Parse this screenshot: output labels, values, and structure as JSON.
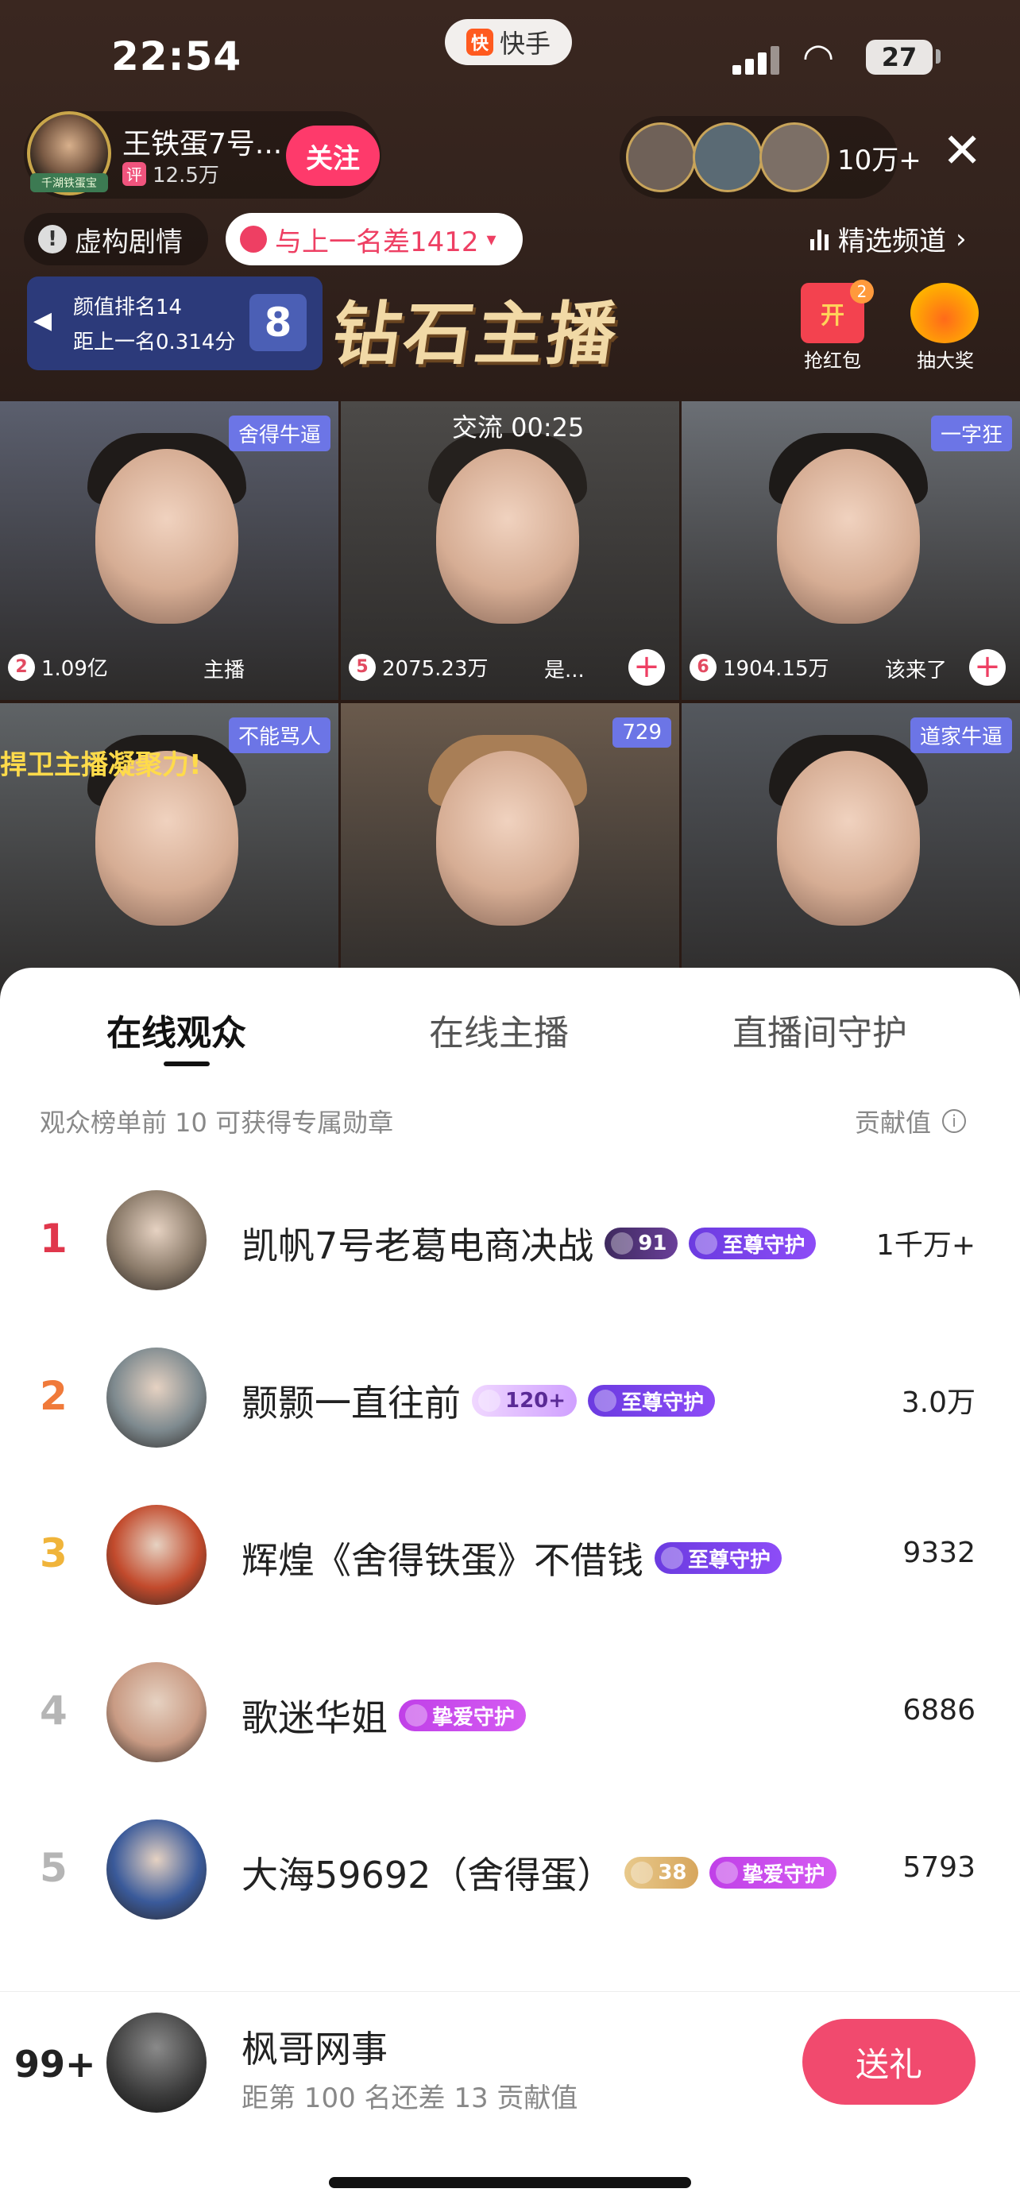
{
  "status_bar": {
    "time": "22:54",
    "app_name": "快手",
    "app_logo_glyph": "快",
    "battery": "27"
  },
  "host": {
    "name": "王铁蛋7号...",
    "badge_text": "千湖铁蛋宝",
    "comment_icon_text": "评",
    "followers": "12.5万",
    "follow_label": "关注"
  },
  "viewers": {
    "count": "10万+"
  },
  "top_pills": {
    "fictional_label": "虚构剧情",
    "gap_label": "与上一名差1412",
    "channel_label": "精选频道"
  },
  "rank_card": {
    "line1": "颜值排名14",
    "line2": "距上一名0.314分"
  },
  "banner_title": "钻石主播",
  "activities": {
    "red_packet": {
      "glyph": "开",
      "count": "2",
      "label": "抢红包"
    },
    "lottery": {
      "label": "抽大奖"
    }
  },
  "grid": {
    "tiles": [
      {
        "tag": "舍得牛逼",
        "rank": "2",
        "count": "1.09亿",
        "note": "主播",
        "bg": "#5b5f6e",
        "hair": "#1f1b19",
        "has_plus": false
      },
      {
        "tag": "",
        "top_text": "交流 00:25",
        "rank": "5",
        "count": "2075.23万",
        "note": "是...",
        "bg": "#4c4a48",
        "hair": "#25211e",
        "has_plus": true
      },
      {
        "tag": "一字狂",
        "rank": "6",
        "count": "1904.15万",
        "note": "该来了",
        "bg": "#6b6f75",
        "hair": "#1d1a18",
        "has_plus": true
      },
      {
        "tag": "不能骂人",
        "banner_text": "捍卫主播凝聚力!",
        "rank": "",
        "count": "",
        "note": "",
        "bg": "#5f6366",
        "hair": "#1f1c1a",
        "has_plus": false
      },
      {
        "tag": "729",
        "rank": "",
        "count": "",
        "note": "",
        "bg": "#6a5a4c",
        "hair": "#a87e56",
        "has_plus": false
      },
      {
        "tag": "道家牛逼",
        "rank": "",
        "count": "",
        "note": "",
        "bg": "#54585e",
        "hair": "#1e1b19",
        "has_plus": false
      }
    ]
  },
  "tabs": {
    "online_audience": "在线观众",
    "online_hosts": "在线主播",
    "room_guard": "直播间守护"
  },
  "list_hint": "观众榜单前 10 可获得专属勋章",
  "contrib_label": "贡献值",
  "info_glyph": "i",
  "audience": [
    {
      "rank": "1",
      "name": "凯帆7号老葛电商决战",
      "level": "91",
      "guard": "至尊守护",
      "value": "1千万+",
      "rank_color": "#e0374c",
      "avatar_bg": "#8b7b6a"
    },
    {
      "rank": "2",
      "name": "颢颢一直往前",
      "level": "120+",
      "guard": "至尊守护",
      "value": "3.0万",
      "rank_color": "#f07a3a",
      "avatar_bg": "#7e8a8f"
    },
    {
      "rank": "3",
      "name": "辉煌《舍得铁蛋》不借钱",
      "level": "",
      "guard": "至尊守护",
      "value": "9332",
      "rank_color": "#f0b43a",
      "avatar_bg": "#c24a2c"
    },
    {
      "rank": "4",
      "name": "歌迷华姐",
      "level": "",
      "guard": "挚爱守护",
      "value": "6886",
      "rank_color": "#b5b5b5",
      "avatar_bg": "#c99b84"
    },
    {
      "rank": "5",
      "name": "大海59692（舍得蛋）",
      "level": "38",
      "guard": "挚爱守护",
      "value": "5793",
      "rank_color": "#b5b5b5",
      "avatar_bg": "#3a5a9a"
    }
  ],
  "footer": {
    "rank": "99+",
    "name": "枫哥网事",
    "sub": "距第 100 名还差 13 贡献值",
    "gift_label": "送礼"
  }
}
